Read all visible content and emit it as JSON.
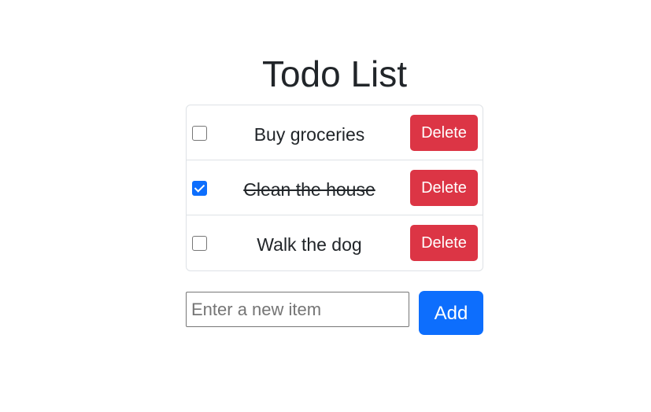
{
  "page": {
    "title": "Todo List"
  },
  "todos": [
    {
      "text": "Buy groceries",
      "completed": false,
      "delete_label": "Delete"
    },
    {
      "text": "Clean the house",
      "completed": true,
      "delete_label": "Delete"
    },
    {
      "text": "Walk the dog",
      "completed": false,
      "delete_label": "Delete"
    }
  ],
  "new_item": {
    "value": "",
    "placeholder": "Enter a new item",
    "add_label": "Add"
  },
  "colors": {
    "danger": "#dc3545",
    "primary": "#0d6efd",
    "border": "#dee2e6",
    "text": "#212529"
  }
}
